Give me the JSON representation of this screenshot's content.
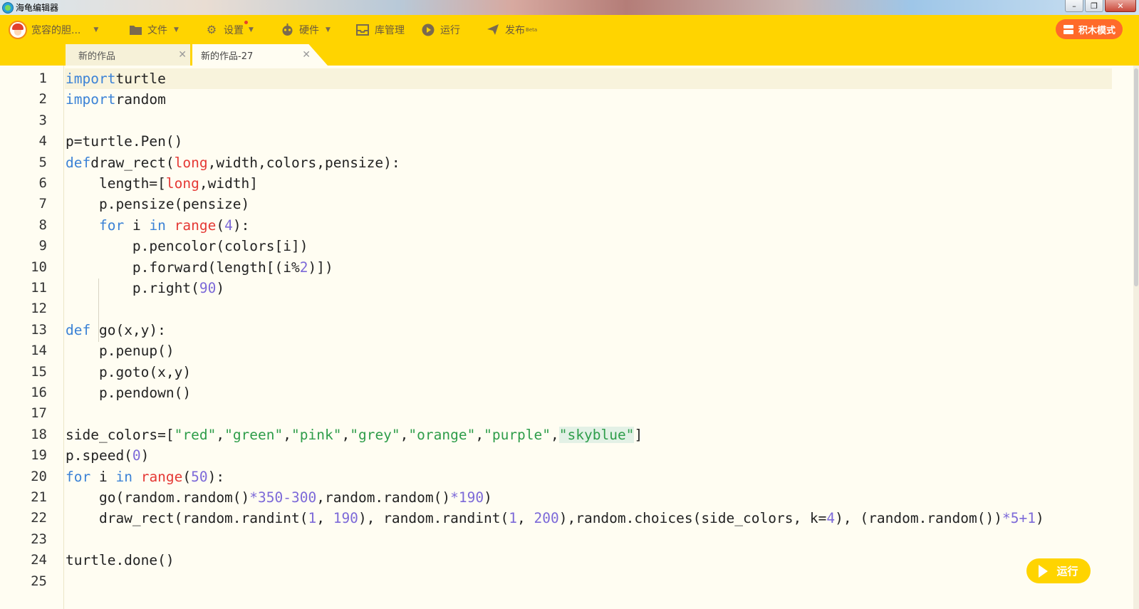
{
  "window": {
    "title": "海龟编辑器",
    "controls": [
      "–",
      "❐",
      "✕"
    ]
  },
  "toolbar": {
    "user_label": "宽容的胆...",
    "file_label": "文件",
    "settings_label": "设置",
    "hardware_label": "硬件",
    "library_label": "库管理",
    "run_label": "运行",
    "publish_label": "发布",
    "publish_badge": "Beta",
    "blocks_mode_label": "积木模式"
  },
  "tabs": [
    {
      "label": "新的作品",
      "active": false
    },
    {
      "label": "新的作品-27",
      "active": true
    }
  ],
  "tab_close": "✕",
  "editor": {
    "line_numbers": [
      "1",
      "2",
      "3",
      "4",
      "5",
      "6",
      "7",
      "8",
      "9",
      "10",
      "11",
      "12",
      "13",
      "14",
      "15",
      "16",
      "17",
      "18",
      "19",
      "20",
      "21",
      "22",
      "23",
      "24",
      "25"
    ],
    "lines": [
      [
        [
          "kw",
          "import"
        ],
        [
          "",
          "turtle"
        ]
      ],
      [
        [
          "kw",
          "import"
        ],
        [
          "",
          "random"
        ]
      ],
      [],
      [
        [
          "",
          "p=turtle.Pen()"
        ]
      ],
      [
        [
          "kw",
          "def"
        ],
        [
          "",
          "draw_rect("
        ],
        [
          "bi",
          "long"
        ],
        [
          "",
          ",width,colors,pensize):"
        ]
      ],
      [
        [
          "",
          "    length=["
        ],
        [
          "bi",
          "long"
        ],
        [
          "",
          ",width]"
        ]
      ],
      [
        [
          "",
          "    p.pensize(pensize)"
        ]
      ],
      [
        [
          "",
          "    "
        ],
        [
          "kw",
          "for"
        ],
        [
          "",
          " i "
        ],
        [
          "kw",
          "in"
        ],
        [
          "",
          " "
        ],
        [
          "bi",
          "range"
        ],
        [
          "",
          "("
        ],
        [
          "num",
          "4"
        ],
        [
          "",
          "):"
        ]
      ],
      [
        [
          "",
          "        p.pencolor(colors[i])"
        ]
      ],
      [
        [
          "",
          "        p.forward(length[(i%"
        ],
        [
          "num",
          "2"
        ],
        [
          "",
          ")])"
        ]
      ],
      [
        [
          "",
          "        p.right("
        ],
        [
          "num",
          "90"
        ],
        [
          "",
          ")"
        ]
      ],
      [],
      [
        [
          "kw",
          "def"
        ],
        [
          "",
          " go(x,y):"
        ]
      ],
      [
        [
          "",
          "    p.penup()"
        ]
      ],
      [
        [
          "",
          "    p.goto(x,y)"
        ]
      ],
      [
        [
          "",
          "    p.pendown()"
        ]
      ],
      [],
      [
        [
          "",
          "side_colors=["
        ],
        [
          "str",
          "\"red\""
        ],
        [
          "",
          ","
        ],
        [
          "str",
          "\"green\""
        ],
        [
          "",
          ","
        ],
        [
          "str",
          "\"pink\""
        ],
        [
          "",
          ","
        ],
        [
          "str",
          "\"grey\""
        ],
        [
          "",
          ","
        ],
        [
          "str",
          "\"orange\""
        ],
        [
          "",
          ","
        ],
        [
          "str",
          "\"purple\""
        ],
        [
          "",
          ","
        ],
        [
          "strhl",
          "\"skyblue\""
        ],
        [
          "",
          "]"
        ]
      ],
      [
        [
          "",
          "p.speed("
        ],
        [
          "num",
          "0"
        ],
        [
          "",
          ")"
        ]
      ],
      [
        [
          "kw",
          "for"
        ],
        [
          "",
          " i "
        ],
        [
          "kw",
          "in"
        ],
        [
          "",
          " "
        ],
        [
          "bi",
          "range"
        ],
        [
          "",
          "("
        ],
        [
          "num",
          "50"
        ],
        [
          "",
          "):"
        ]
      ],
      [
        [
          "",
          "    go(random.random()"
        ],
        [
          "op",
          "*"
        ],
        [
          "num",
          "350"
        ],
        [
          "op",
          "-"
        ],
        [
          "num",
          "300"
        ],
        [
          "",
          ",random.random()"
        ],
        [
          "op",
          "*"
        ],
        [
          "num",
          "190"
        ],
        [
          "",
          ")"
        ]
      ],
      [
        [
          "",
          "    draw_rect(random.randint("
        ],
        [
          "num",
          "1"
        ],
        [
          "",
          ", "
        ],
        [
          "num",
          "190"
        ],
        [
          "",
          "), random.randint("
        ],
        [
          "num",
          "1"
        ],
        [
          "",
          ", "
        ],
        [
          "num",
          "200"
        ],
        [
          "",
          "),random.choices(side_colors, k="
        ],
        [
          "num",
          "4"
        ],
        [
          "",
          "), (random.random())"
        ],
        [
          "op",
          "*"
        ],
        [
          "num",
          "5"
        ],
        [
          "op",
          "+"
        ],
        [
          "num",
          "1"
        ],
        [
          "",
          ")"
        ]
      ],
      [],
      [
        [
          "",
          "turtle.done()"
        ]
      ],
      []
    ]
  },
  "run_button_label": "运行",
  "colors": {
    "toolbar_bg": "#ffd400",
    "editor_bg": "#fffdf2",
    "keyword": "#3b82d6",
    "builtin": "#e53935",
    "number": "#7c69d8",
    "string": "#2e9d4a",
    "blocks_button": "#ff6a2a"
  }
}
